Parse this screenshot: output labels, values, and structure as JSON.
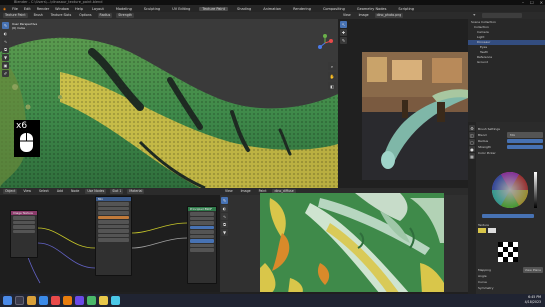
{
  "titlebar": {
    "title": "Blender - C:\\Users\\...\\dinosaur_texture_paint.blend"
  },
  "menubar": {
    "items": [
      "File",
      "Edit",
      "Render",
      "Window",
      "Help"
    ],
    "workspaces": [
      "Layout",
      "Modeling",
      "Sculpting",
      "UV Editing",
      "Texture Paint",
      "Shading",
      "Animation",
      "Rendering",
      "Compositing",
      "Geometry Nodes",
      "Scripting"
    ],
    "active_workspace": "Texture Paint",
    "scene": "Scene",
    "view_layer": "ViewLayer"
  },
  "viewport": {
    "mode": "Texture Paint",
    "header_items": [
      "Brush",
      "Texture Slots",
      "Options",
      "Radius",
      "Strength"
    ],
    "overlay_text_1": "User Perspective",
    "overlay_text_2": "(0) Cube",
    "brush_indicator": "x6"
  },
  "preview": {
    "header_items": [
      "View",
      "Image",
      "dino_photo.png"
    ]
  },
  "outliner": {
    "rows": [
      "Scene Collection",
      "Collection",
      "Camera",
      "Light",
      "Dinosaur",
      "Eyes",
      "Teeth",
      "Reference",
      "Ground"
    ],
    "selected_index": 4
  },
  "props": {
    "labels": [
      "Brush Settings",
      "Blend",
      "Mix",
      "Radius",
      "Strength",
      "Color Picker",
      "Texture",
      "Mapping",
      "View Plane",
      "Angle",
      "Curve",
      "Symmetry"
    ]
  },
  "nodes": {
    "header_items": [
      "Object",
      "View",
      "Select",
      "Add",
      "Node",
      "Use Nodes",
      "Slot 1",
      "Material"
    ],
    "node_titles": [
      "Image Texture",
      "Mix",
      "Principled BSDF",
      "Material Output",
      "ColorRamp"
    ]
  },
  "uv": {
    "header_items": [
      "View",
      "Image",
      "Paint",
      "dino_diffuse"
    ]
  },
  "taskbar": {
    "time": "6:45 PM",
    "date": "4/18/2023"
  },
  "colors": {
    "accent": "#4772b3",
    "skin_green": "#3f8a4a",
    "skin_yellow": "#d9c64a"
  }
}
